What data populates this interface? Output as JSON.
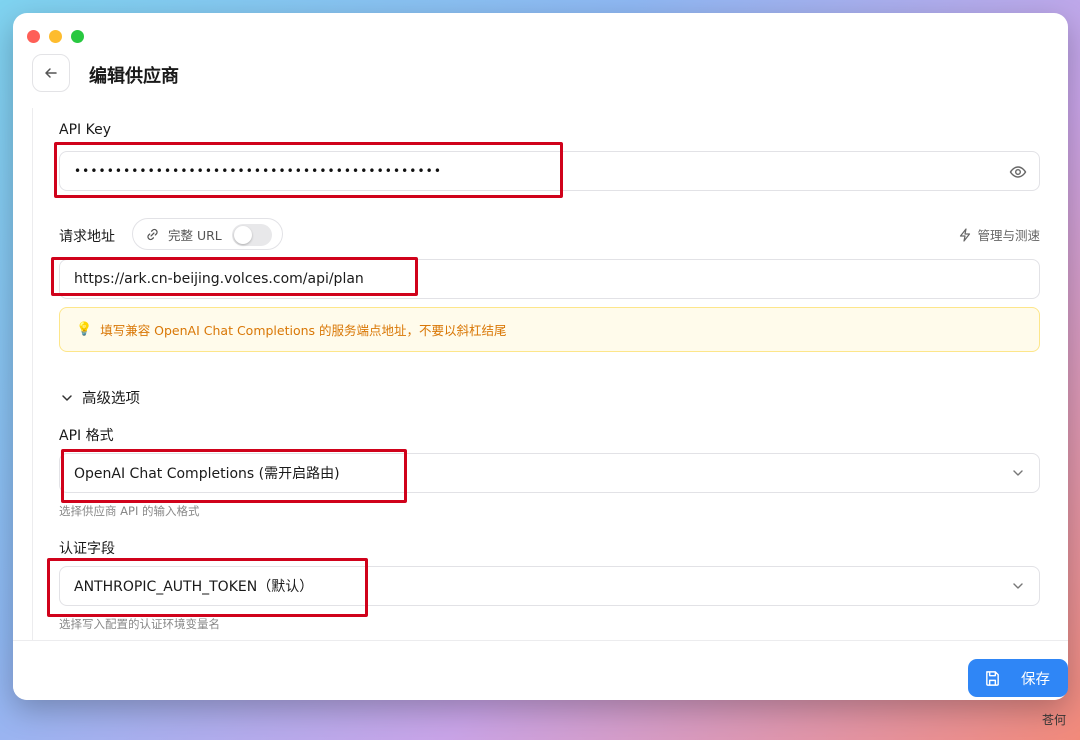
{
  "header": {
    "title": "编辑供应商"
  },
  "api_key": {
    "label": "API Key",
    "masked_value": "•••••••••••••••••••••••••••••••••••••••••••••"
  },
  "request_url": {
    "label": "请求地址",
    "full_url_toggle_label": "完整 URL",
    "full_url_enabled": false,
    "manage_label": "管理与测速",
    "value": "https://ark.cn-beijing.volces.com/api/plan",
    "hint": "填写兼容 OpenAI Chat Completions 的服务端点地址，不要以斜杠结尾"
  },
  "advanced": {
    "label": "高级选项",
    "api_format": {
      "label": "API 格式",
      "value": "OpenAI Chat Completions (需开启路由)",
      "help": "选择供应商 API 的输入格式"
    },
    "auth_field": {
      "label": "认证字段",
      "value": "ANTHROPIC_AUTH_TOKEN（默认）",
      "help": "选择写入配置的认证环境变量名"
    }
  },
  "footer": {
    "save_label": "保存"
  },
  "watermark": "苍何",
  "colors": {
    "accent": "#2f86f6",
    "highlight": "#d0021b",
    "hint_text": "#d97706"
  }
}
